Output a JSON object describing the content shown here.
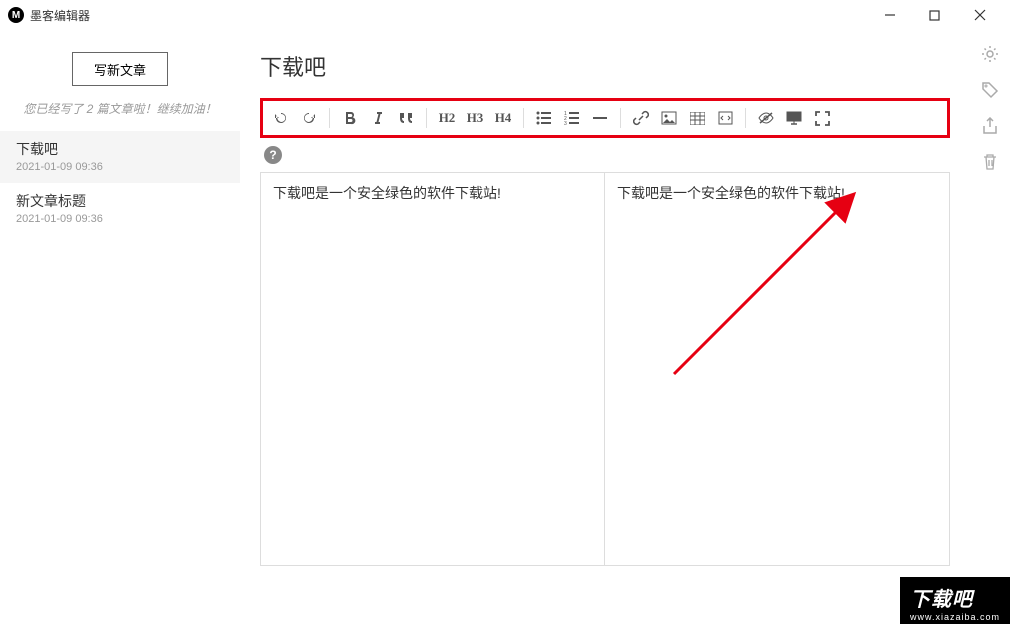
{
  "app": {
    "title": "墨客编辑器",
    "iconLetter": "M"
  },
  "winControls": {
    "min": "—",
    "max": "□",
    "close": "×"
  },
  "sidebar": {
    "newBtn": "写新文章",
    "stat": "您已经写了 2 篇文章啦！继续加油！",
    "items": [
      {
        "title": "下载吧",
        "date": "2021-01-09 09:36"
      },
      {
        "title": "新文章标题",
        "date": "2021-01-09 09:36"
      }
    ]
  },
  "doc": {
    "title": "下载吧"
  },
  "toolbar": {
    "h2": "H2",
    "h3": "H3",
    "h4": "H4"
  },
  "editor": {
    "source": "下载吧是一个安全绿色的软件下载站!",
    "preview": "下载吧是一个安全绿色的软件下载站!"
  },
  "watermark": {
    "main": "下载吧",
    "sub": "www.xiazaiba.com"
  }
}
